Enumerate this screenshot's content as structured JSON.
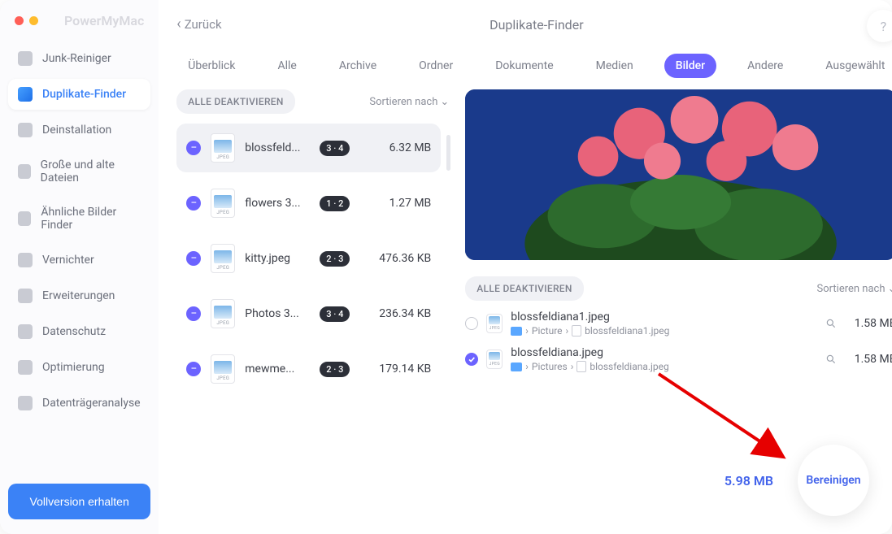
{
  "brand": "PowerMyMac",
  "back_label": "Zurück",
  "page_title": "Duplikate-Finder",
  "help_label": "?",
  "cta_label": "Vollversion erhalten",
  "sidebar": {
    "items": [
      {
        "label": "Junk-Reiniger"
      },
      {
        "label": "Duplikate-Finder"
      },
      {
        "label": "Deinstallation"
      },
      {
        "label": "Große und alte Dateien"
      },
      {
        "label": "Ähnliche Bilder Finder"
      },
      {
        "label": "Vernichter"
      },
      {
        "label": "Erweiterungen"
      },
      {
        "label": "Datenschutz"
      },
      {
        "label": "Optimierung"
      },
      {
        "label": "Datenträgeranalyse"
      }
    ]
  },
  "tabs": [
    "Überblick",
    "Alle",
    "Archive",
    "Ordner",
    "Dokumente",
    "Medien",
    "Bilder",
    "Andere",
    "Ausgewählt"
  ],
  "active_tab": 6,
  "toolbar": {
    "deselect_all": "ALLE DEAKTIVIEREN",
    "sort_by": "Sortieren nach"
  },
  "groups": [
    {
      "name": "blossfeld...",
      "count": "3 · 4",
      "size": "6.32 MB"
    },
    {
      "name": "flowers 3...",
      "count": "1 · 2",
      "size": "1.27 MB"
    },
    {
      "name": "kitty.jpeg",
      "count": "2 · 3",
      "size": "476.36 KB"
    },
    {
      "name": "Photos 3...",
      "count": "3 · 4",
      "size": "236.34 KB"
    },
    {
      "name": "mewme...",
      "count": "2 · 3",
      "size": "179.14 KB"
    }
  ],
  "details": [
    {
      "selected": false,
      "name": "blossfeldiana1.jpeg",
      "folder": "Picture",
      "file": "blossfeldiana1.jpeg",
      "size": "1.58 MB"
    },
    {
      "selected": true,
      "name": "blossfeldiana.jpeg",
      "folder": "Pictures",
      "file": "blossfeldiana.jpeg",
      "size": "1.58 MB"
    }
  ],
  "path_sep": "›",
  "total_size": "5.98 MB",
  "clean_label": "Bereinigen",
  "file_type_label": "JPEG"
}
